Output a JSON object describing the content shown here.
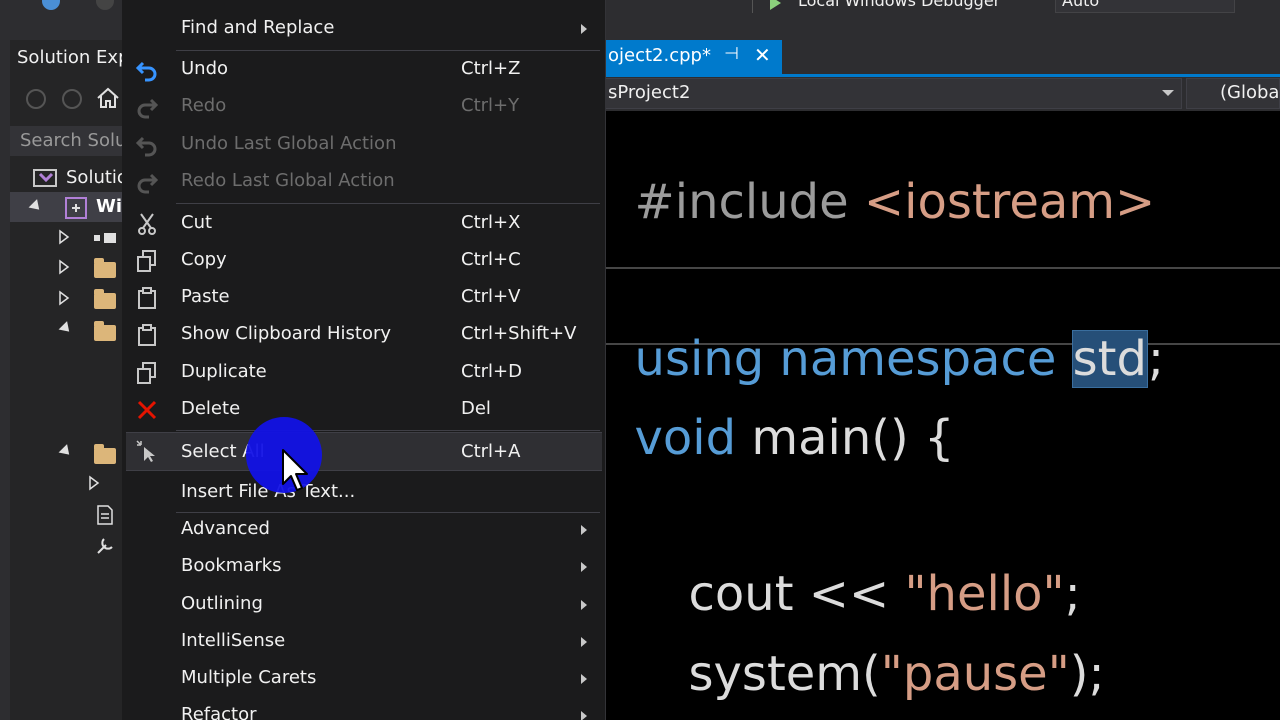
{
  "toolbar": {
    "debugger_label": "Local Windows Debugger",
    "config_value": "Auto"
  },
  "solution_explorer": {
    "title": "Solution Exp",
    "search_placeholder": "Search Solu",
    "root_label": "Solutio",
    "project_label": "Wi"
  },
  "editor": {
    "tab_label": "oject2.cpp*",
    "tab_pin": "⊣",
    "tab_close": "✕",
    "nav_project": "sProject2",
    "nav_scope": "(Globa",
    "code": {
      "line1_pre": "#include ",
      "line1_str": "<iostream>",
      "line2_kw": "using namespace ",
      "line2_sel": "std",
      "line2_end": ";",
      "line3_kw": "void",
      "line3_txt": " main() {",
      "line4_txt": "cout << ",
      "line4_str": "\"hello\"",
      "line4_end": ";",
      "line5_txt": "system(",
      "line5_str": "\"pause\"",
      "line5_end": ");"
    }
  },
  "context_menu": {
    "items": [
      {
        "label": "Find and Replace",
        "shortcut": "",
        "submenu": true,
        "enabled": true,
        "icon": ""
      },
      {
        "label": "Undo",
        "shortcut": "Ctrl+Z",
        "submenu": false,
        "enabled": true,
        "icon": "undo-icon"
      },
      {
        "label": "Redo",
        "shortcut": "Ctrl+Y",
        "submenu": false,
        "enabled": false,
        "icon": "redo-icon"
      },
      {
        "label": "Undo Last Global Action",
        "shortcut": "",
        "submenu": false,
        "enabled": false,
        "icon": "undo-global-icon"
      },
      {
        "label": "Redo Last Global Action",
        "shortcut": "",
        "submenu": false,
        "enabled": false,
        "icon": "redo-global-icon"
      },
      {
        "label": "Cut",
        "shortcut": "Ctrl+X",
        "submenu": false,
        "enabled": true,
        "icon": "scissors-icon"
      },
      {
        "label": "Copy",
        "shortcut": "Ctrl+C",
        "submenu": false,
        "enabled": true,
        "icon": "copy-icon"
      },
      {
        "label": "Paste",
        "shortcut": "Ctrl+V",
        "submenu": false,
        "enabled": true,
        "icon": "paste-icon"
      },
      {
        "label": "Show Clipboard History",
        "shortcut": "Ctrl+Shift+V",
        "submenu": false,
        "enabled": true,
        "icon": "clipboard-icon"
      },
      {
        "label": "Duplicate",
        "shortcut": "Ctrl+D",
        "submenu": false,
        "enabled": true,
        "icon": "duplicate-icon"
      },
      {
        "label": "Delete",
        "shortcut": "Del",
        "submenu": false,
        "enabled": true,
        "icon": "delete-icon"
      },
      {
        "label": "Select All",
        "shortcut": "Ctrl+A",
        "submenu": false,
        "enabled": true,
        "icon": "select-all-icon"
      },
      {
        "label": "Insert File As Text...",
        "shortcut": "",
        "submenu": false,
        "enabled": true,
        "icon": ""
      },
      {
        "label": "Advanced",
        "shortcut": "",
        "submenu": true,
        "enabled": true,
        "icon": ""
      },
      {
        "label": "Bookmarks",
        "shortcut": "",
        "submenu": true,
        "enabled": true,
        "icon": ""
      },
      {
        "label": "Outlining",
        "shortcut": "",
        "submenu": true,
        "enabled": true,
        "icon": ""
      },
      {
        "label": "IntelliSense",
        "shortcut": "",
        "submenu": true,
        "enabled": true,
        "icon": ""
      },
      {
        "label": "Multiple Carets",
        "shortcut": "",
        "submenu": true,
        "enabled": true,
        "icon": ""
      },
      {
        "label": "Refactor",
        "shortcut": "",
        "submenu": true,
        "enabled": true,
        "icon": ""
      }
    ]
  },
  "colors": {
    "accent": "#007acc",
    "menu_bg": "#1b1b1c",
    "cursor_halo": "#1212e6",
    "delete_icon": "#e51400",
    "undo_icon": "#3794ff"
  }
}
